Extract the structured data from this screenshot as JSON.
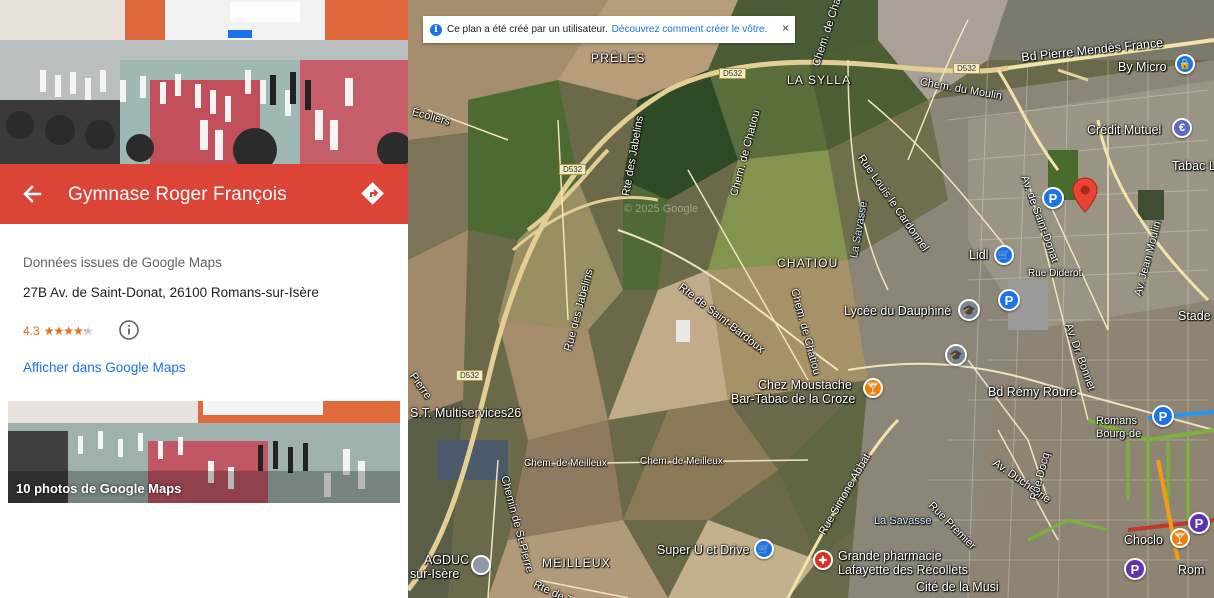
{
  "panel": {
    "title": "Gymnase Roger François",
    "source": "Données issues de Google Maps",
    "address": "27B Av. de Saint-Donat, 26100 Romans-sur-Isère",
    "rating": "4.3",
    "stars_value": 4.3,
    "stars_max": 5,
    "stars_text": "★★★★★",
    "maps_link": "Afficher dans Google Maps",
    "photos_label": "10 photos de Google Maps",
    "header_color": "#db4437",
    "icons": {
      "back": "arrow-left-icon",
      "directions": "directions-icon",
      "info": "info-icon"
    }
  },
  "banner": {
    "text": "Ce plan a été créé par un utilisateur.",
    "link": "Découvrez comment créer le vôtre.",
    "close": "×"
  },
  "map": {
    "labels": {
      "preles": "PRÊLES",
      "sylla": "LA SYLLA",
      "chatiou": "CHATIOU",
      "meilleux": "MEILLEUX",
      "bd_pmf": "Bd Pierre Mendès France",
      "bymicro": "By Micro",
      "credit": "Crédit Mutuel",
      "tabac": "Tabac Les",
      "lidl": "Lidl",
      "diderot": "Rue Diderot",
      "lycee": "Lycée du Dauphiné",
      "stade": "Stade M",
      "moustache1": "Chez Moustache",
      "moustache2": "Bar-Tabac de la Croze",
      "remy": "Bd Rémy Roure",
      "romans": "Romans",
      "bourg": "Bourg-de",
      "multi": "S.T. Multiservices26",
      "meilleux_r1": "Chem. de Meilleux",
      "meilleux_r2": "Chem. de Meilleux",
      "superu": "Super U et Drive",
      "pharm1": "Grande pharmacie",
      "pharm2": "Lafayette des Récollets",
      "cite": "Cité de la Musi",
      "agduc1": "AGDUC",
      "agduc2": "sur-Isère",
      "choclo": "Choclo",
      "rom": "Rom",
      "savasse": "La Savasse",
      "savasse2": "La Savasse",
      "ecoliers": "Écoliers",
      "pierre": "Pierre",
      "moulin": "Chem. du Moulin",
      "rte_jabelins": "Rte des Jabelins",
      "rue_jabelins": "Rue des Jabelins",
      "rte_bardoux": "Rte de Saint-Bardoux",
      "rue_cardonnel": "Rue Louis le Cardonnel",
      "av_donat": "Av. de Saint-Donat",
      "av_bonnet": "Av. Dr. Bonnet",
      "av_moulin": "Av. Jean Moulin",
      "chatiou_chem": "Chem. de Chatiou",
      "chatiou_chem2": "Chem. de Chatiou",
      "chatiou_chem3": "Chem. de Chatiou",
      "rue_abbat": "Rue Simone Abbat",
      "av_duchesne": "Av. Duchesne",
      "rue_docq": "Rue Docq",
      "rue_premier": "Rue Premier",
      "chem_stpierre": "Chemin de St-Pierre",
      "rte_tain": "Rte de Tain",
      "watermark": "© 2025 Google"
    },
    "shields": [
      "D532",
      "D532",
      "D532",
      "D532",
      "D532"
    ],
    "pins": {
      "parking": "P",
      "lidl": "🛒",
      "school": "🎓",
      "food": "🍸",
      "pharmacy": "✚",
      "shopping": "🛒",
      "bank": "€",
      "lock": "🔒"
    }
  }
}
